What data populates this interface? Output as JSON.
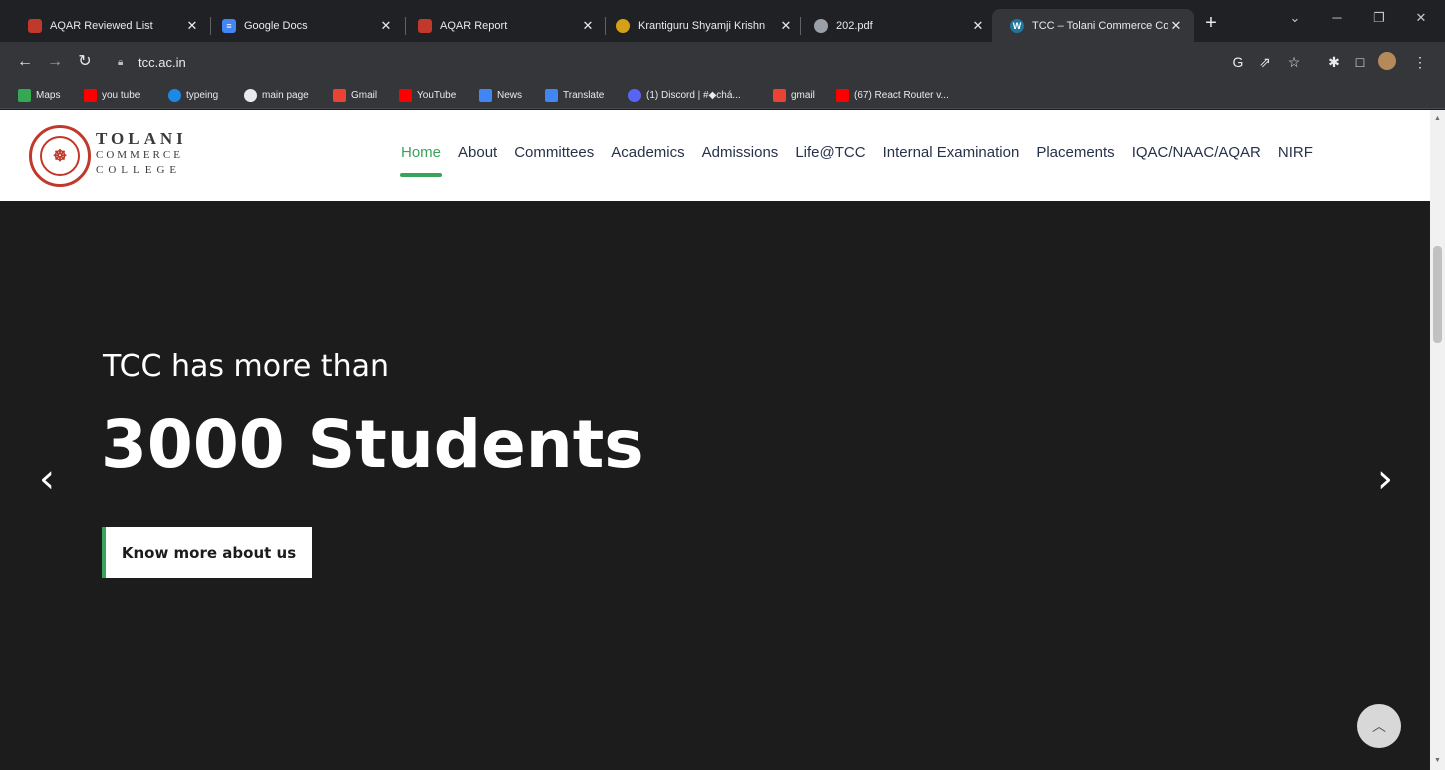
{
  "browser": {
    "tabs": [
      {
        "title": "AQAR Reviewed List",
        "favicon": "red-badge-icon",
        "color": "#c0392b"
      },
      {
        "title": "Google Docs",
        "favicon": "docs-icon",
        "color": "#4285f4"
      },
      {
        "title": "AQAR Report",
        "favicon": "red-badge-icon",
        "color": "#c0392b"
      },
      {
        "title": "Krantiguru Shyamji Krishn",
        "favicon": "site-icon",
        "color": "#d4a017"
      },
      {
        "title": "202.pdf",
        "favicon": "globe-icon",
        "color": "#9aa0a6"
      },
      {
        "title": "TCC – Tolani Commerce Co",
        "favicon": "wordpress-icon",
        "color": "#21759b"
      }
    ],
    "new_tab": "+",
    "address": "tcc.ac.in",
    "bookmarks": [
      {
        "label": "Maps",
        "color": "#34a853"
      },
      {
        "label": "you tube",
        "color": "#ff0000"
      },
      {
        "label": "typeing",
        "color": "#1e88e5"
      },
      {
        "label": "main page",
        "color": "#e8eaed"
      },
      {
        "label": "Gmail",
        "color": "#ea4335"
      },
      {
        "label": "YouTube",
        "color": "#ff0000"
      },
      {
        "label": "News",
        "color": "#4285f4"
      },
      {
        "label": "Translate",
        "color": "#4285f4"
      },
      {
        "label": "(1) Discord | #◆chá...",
        "color": "#5865f2"
      },
      {
        "label": "gmail",
        "color": "#ea4335"
      },
      {
        "label": "(67) React Router v...",
        "color": "#ff0000"
      }
    ]
  },
  "site": {
    "brand": {
      "line1": "TOLANI",
      "line2": "COMMERCE",
      "line3": "COLLEGE"
    },
    "nav": [
      "Home",
      "About",
      "Committees",
      "Academics",
      "Admissions",
      "Life@TCC",
      "Internal Examination",
      "Placements",
      "IQAC/NAAC/AQAR",
      "NIRF"
    ],
    "active_nav": "Home",
    "accent_color": "#3aa35b"
  },
  "hero": {
    "subtitle": "TCC has more than",
    "headline": "3000 Students",
    "cta": "Know more about us",
    "prev_arrow": "‹",
    "next_arrow": "›"
  }
}
